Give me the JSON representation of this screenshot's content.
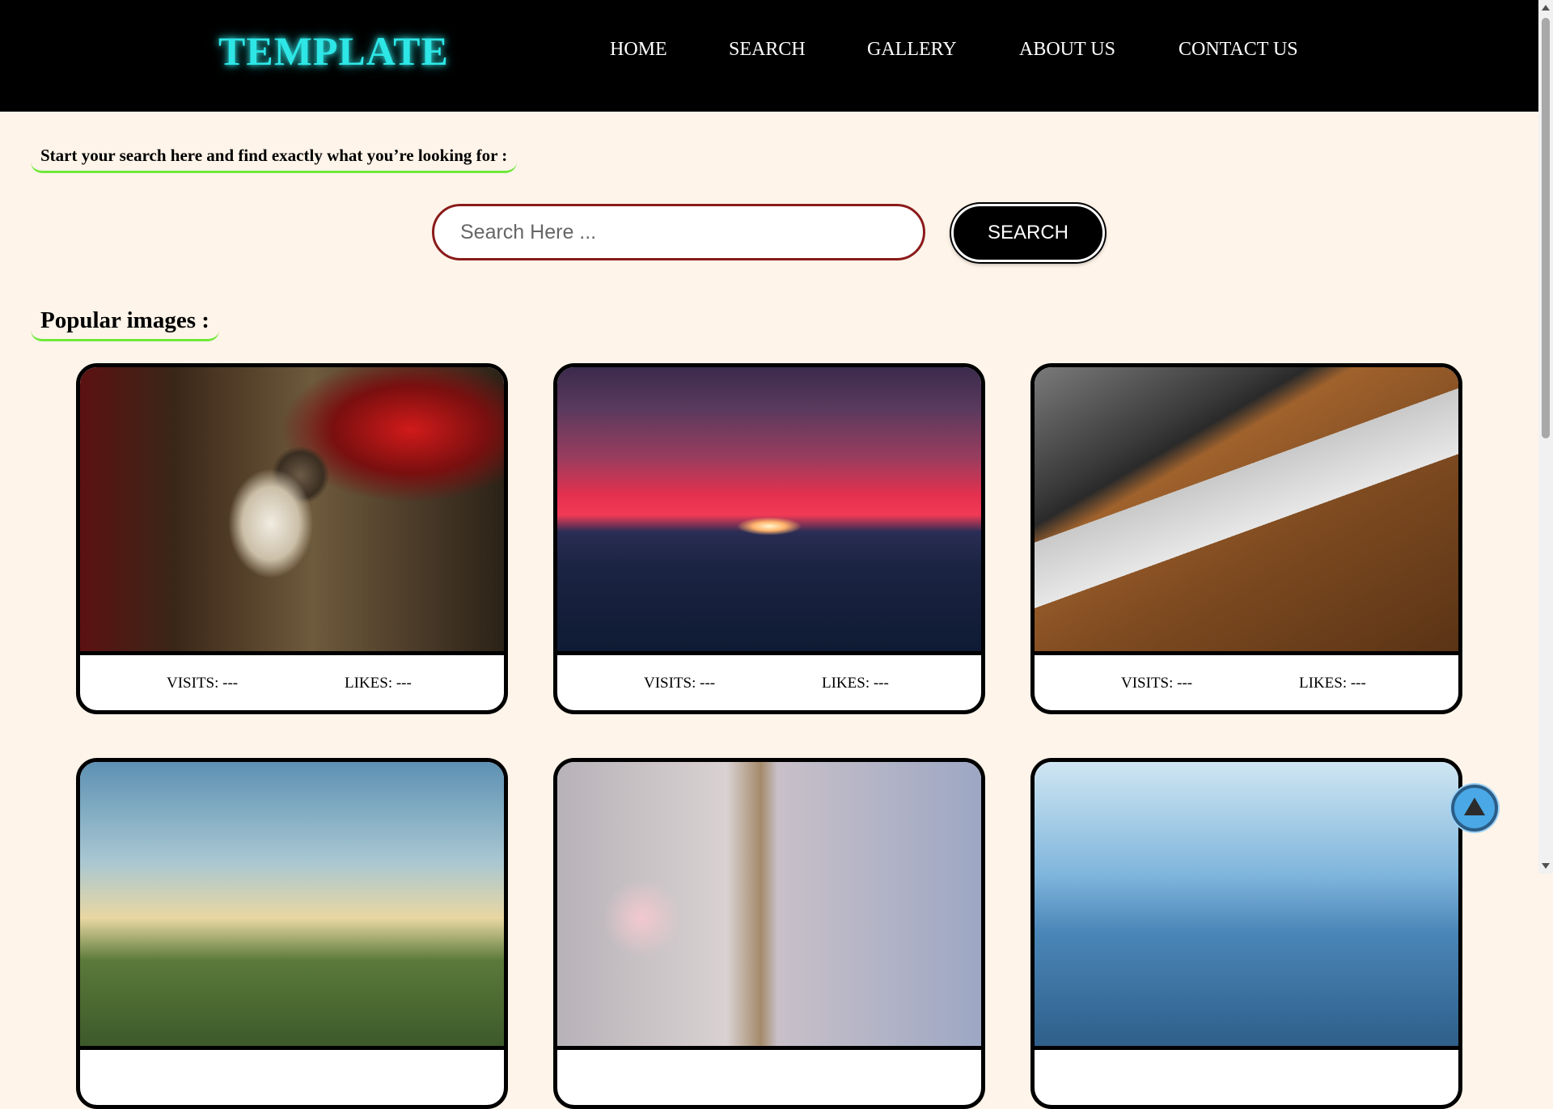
{
  "header": {
    "logo": "TEMPLATE",
    "nav": [
      "HOME",
      "SEARCH",
      "GALLERY",
      "ABOUT US",
      "CONTACT US"
    ]
  },
  "search": {
    "prompt": "Start your search here and find exactly what you’re looking for :",
    "placeholder": "Search Here ...",
    "button_label": "SEARCH"
  },
  "popular": {
    "heading": "Popular images :",
    "cards": [
      {
        "image": "cat-photo",
        "visits": "VISITS: ---",
        "likes": "LIKES: ---"
      },
      {
        "image": "sunset-photo",
        "visits": "VISITS: ---",
        "likes": "LIKES: ---"
      },
      {
        "image": "desk-laptop-photo",
        "visits": "VISITS: ---",
        "likes": "LIKES: ---"
      },
      {
        "image": "coastal-cliff-photo"
      },
      {
        "image": "dessert-photo"
      },
      {
        "image": "mountain-lake-photo"
      }
    ]
  },
  "icons": {
    "back_to_top": "triangle-up-icon"
  },
  "colors": {
    "page_background": "#fef4e9",
    "header_background": "#000000",
    "logo": "#2ee6e6",
    "heading_underline": "#6fe83a",
    "search_border": "#8b1a1a",
    "back_to_top": "#4aa8e6"
  }
}
